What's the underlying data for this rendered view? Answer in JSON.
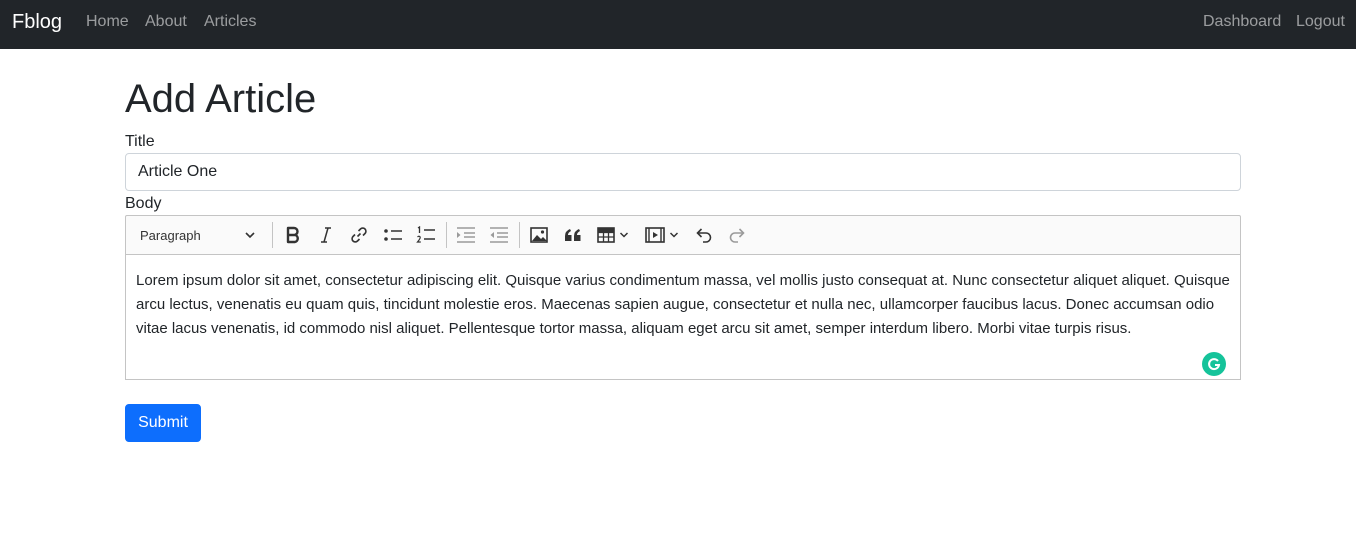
{
  "navbar": {
    "brand": "Fblog",
    "links_left": [
      {
        "label": "Home"
      },
      {
        "label": "About"
      },
      {
        "label": "Articles"
      }
    ],
    "links_right": [
      {
        "label": "Dashboard"
      },
      {
        "label": "Logout"
      }
    ]
  },
  "page": {
    "title": "Add Article"
  },
  "form": {
    "title_label": "Title",
    "title_value": "Article One",
    "body_label": "Body",
    "submit_label": "Submit"
  },
  "editor": {
    "heading_select": "Paragraph",
    "toolbar_icons": [
      "bold-icon",
      "italic-icon",
      "link-icon",
      "bulleted-list-icon",
      "numbered-list-icon",
      "outdent-icon",
      "indent-icon",
      "image-icon",
      "blockquote-icon",
      "table-icon",
      "media-embed-icon",
      "undo-icon",
      "redo-icon"
    ],
    "content": "Lorem ipsum dolor sit amet, consectetur adipiscing elit. Quisque varius condimentum massa, vel mollis justo consequat at. Nunc consectetur aliquet aliquet. Quisque arcu lectus, venenatis eu quam quis, tincidunt molestie eros. Maecenas sapien augue, consectetur et nulla nec, ullamcorper faucibus lacus. Donec accumsan odio vitae lacus venenatis, id commodo nisl aliquet. Pellentesque tortor massa, aliquam eget arcu sit amet, semper interdum libero. Morbi vitae turpis risus."
  },
  "colors": {
    "navbar_bg": "#212529",
    "primary": "#0d6efd",
    "grammarly": "#15c39a"
  }
}
